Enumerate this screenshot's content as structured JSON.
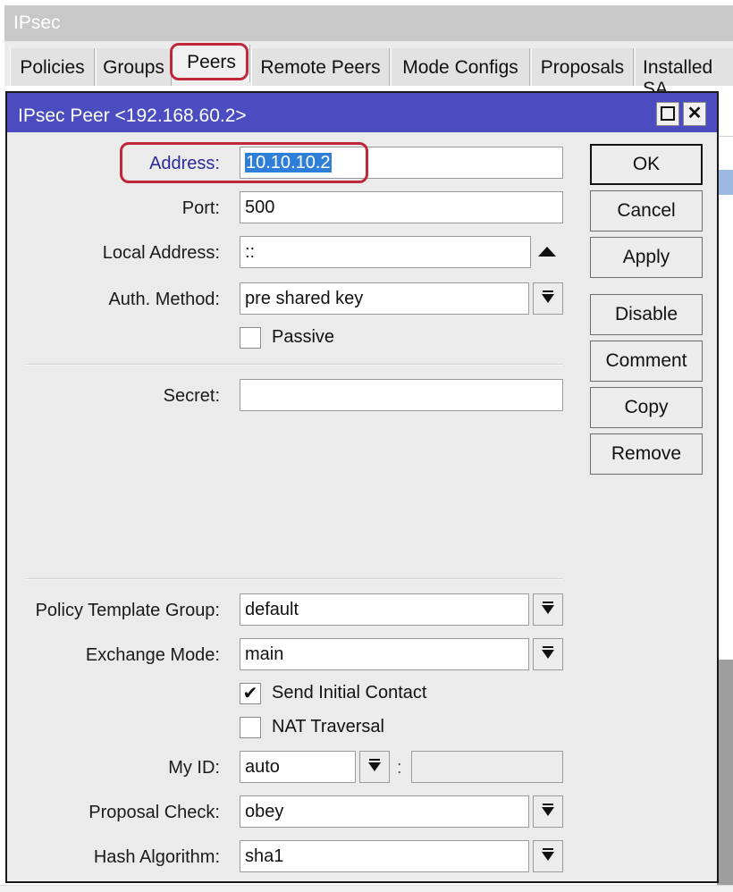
{
  "parent_window": {
    "title": "IPsec",
    "tabs": [
      {
        "label": "Policies",
        "active": false
      },
      {
        "label": "Groups",
        "active": false
      },
      {
        "label": "Peers",
        "active": true
      },
      {
        "label": "Remote Peers",
        "active": false
      },
      {
        "label": "Mode Configs",
        "active": false
      },
      {
        "label": "Proposals",
        "active": false
      },
      {
        "label": "Installed SA",
        "active": false
      }
    ]
  },
  "dialog": {
    "title": "IPsec Peer <192.168.60.2>",
    "icons": {
      "maximize": "maximize-icon",
      "close": "close-icon"
    },
    "close_glyph": "✕",
    "fields": {
      "address": {
        "label": "Address:",
        "value": "10.10.10.2"
      },
      "port": {
        "label": "Port:",
        "value": "500"
      },
      "local_address": {
        "label": "Local Address:",
        "value": "::"
      },
      "auth_method": {
        "label": "Auth. Method:",
        "value": "pre shared key"
      },
      "passive": {
        "label": "Passive",
        "checked": false
      },
      "secret": {
        "label": "Secret:",
        "value": ""
      },
      "policy_template_group": {
        "label": "Policy Template Group:",
        "value": "default"
      },
      "exchange_mode": {
        "label": "Exchange Mode:",
        "value": "main"
      },
      "send_initial_contact": {
        "label": "Send Initial Contact",
        "checked": true,
        "glyph": "✔"
      },
      "nat_traversal": {
        "label": "NAT Traversal",
        "checked": false
      },
      "my_id": {
        "label": "My ID:",
        "value": "auto",
        "separator": ":",
        "extra_value": ""
      },
      "proposal_check": {
        "label": "Proposal Check:",
        "value": "obey"
      },
      "hash_algorithm": {
        "label": "Hash Algorithm:",
        "value": "sha1"
      }
    },
    "buttons": {
      "ok": "OK",
      "cancel": "Cancel",
      "apply": "Apply",
      "disable": "Disable",
      "comment": "Comment",
      "copy": "Copy",
      "remove": "Remove"
    }
  },
  "colors": {
    "dialog_title_bg": "#4a4cc0",
    "annotation_red": "#c0283a",
    "selection_blue": "#2f7fd8",
    "address_label_blue": "#2a2a9a"
  }
}
